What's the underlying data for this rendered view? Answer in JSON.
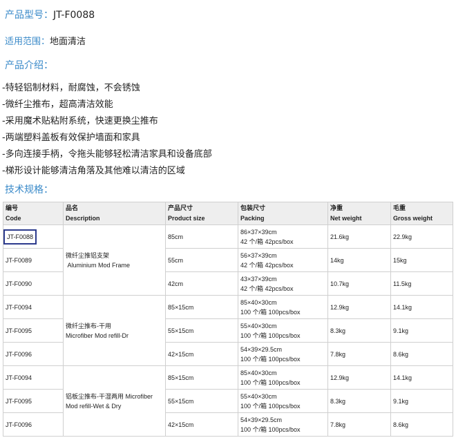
{
  "header": {
    "model_label": "产品型号：",
    "model_value": "JT-F0088",
    "scope_label": "适用范围：",
    "scope_value": "地面清洁",
    "intro_title": "产品介绍：",
    "features": [
      "-特轻铝制材料，耐腐蚀，不会锈蚀",
      "-微纤尘推布，超高清洁效能",
      "-采用魔术贴粘附系统，快速更换尘推布",
      "-两端塑料盖板有效保护墙面和家具",
      "-多向连接手柄，令拖头能够轻松清洁家具和设备底部",
      "-梯形设计能够清洁角落及其他难以清洁的区域"
    ],
    "spec_title": "技术规格："
  },
  "table": {
    "headers": [
      {
        "cn": "编号",
        "en": "Code"
      },
      {
        "cn": "品名",
        "en": "Description"
      },
      {
        "cn": "产品尺寸",
        "en": "Product size"
      },
      {
        "cn": "包装尺寸",
        "en": "Packing"
      },
      {
        "cn": "净重",
        "en": "Net weight"
      },
      {
        "cn": "毛重",
        "en": "Gross weight"
      }
    ],
    "groups": [
      {
        "desc_cn": "微纤尘推铝支架",
        "desc_en": "Aluminium Mod Frame"
      },
      {
        "desc_cn": "微纤尘推布-干用",
        "desc_en": "Microfiber Mod refill-Dr"
      },
      {
        "desc_cn": "铝板尘推布-干湿两用 Microfiber",
        "desc_en": "Mod refill-Wet & Dry"
      }
    ],
    "rows": [
      {
        "code": "JT-F0088",
        "size": "85cm",
        "pack1": "86×37×39cm",
        "pack2": "42 个/箱 42pcs/box",
        "net": "21.6kg",
        "gross": "22.9kg"
      },
      {
        "code": "JT-F0089",
        "size": "55cm",
        "pack1": "56×37×39cm",
        "pack2": "42 个/箱 42pcs/box",
        "net": "14kg",
        "gross": "15kg"
      },
      {
        "code": "JT-F0090",
        "size": "42cm",
        "pack1": "43×37×39cm",
        "pack2": "42 个/箱 42pcs/box",
        "net": "10.7kg",
        "gross": "11.5kg"
      },
      {
        "code": "JT-F0094",
        "size": "85×15cm",
        "pack1": "85×40×30cm",
        "pack2": "100 个/箱 100pcs/box",
        "net": "12.9kg",
        "gross": "14.1kg"
      },
      {
        "code": "JT-F0095",
        "size": "55×15cm",
        "pack1": "55×40×30cm",
        "pack2": "100 个/箱 100pcs/box",
        "net": "8.3kg",
        "gross": "9.1kg"
      },
      {
        "code": "JT-F0096",
        "size": "42×15cm",
        "pack1": "54×39×29.5cm",
        "pack2": "100 个/箱 100pcs/box",
        "net": "7.8kg",
        "gross": "8.6kg"
      },
      {
        "code": "JT-F0094",
        "size": "85×15cm",
        "pack1": "85×40×30cm",
        "pack2": "100 个/箱 100pcs/box",
        "net": "12.9kg",
        "gross": "14.1kg"
      },
      {
        "code": "JT-F0095",
        "size": "55×15cm",
        "pack1": "55×40×30cm",
        "pack2": "100 个/箱 100pcs/box",
        "net": "8.3kg",
        "gross": "9.1kg"
      },
      {
        "code": "JT-F0096",
        "size": "42×15cm",
        "pack1": "54×39×29.5cm",
        "pack2": "100 个/箱 100pcs/box",
        "net": "7.8kg",
        "gross": "8.6kg"
      }
    ]
  }
}
